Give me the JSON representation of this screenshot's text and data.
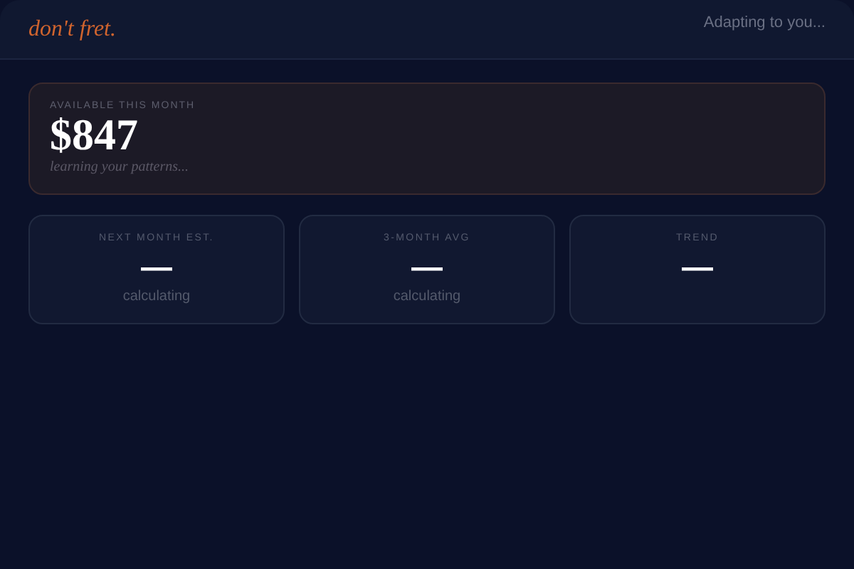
{
  "header": {
    "logo": "don't fret.",
    "status": "Adapting to you..."
  },
  "hero": {
    "label": "AVAILABLE THIS MONTH",
    "amount": "$847",
    "note": "learning your patterns..."
  },
  "stats": [
    {
      "label": "NEXT MONTH EST.",
      "value": "—",
      "note": "calculating"
    },
    {
      "label": "3-MONTH AVG",
      "value": "—",
      "note": "calculating"
    },
    {
      "label": "TREND",
      "value": "—"
    }
  ]
}
